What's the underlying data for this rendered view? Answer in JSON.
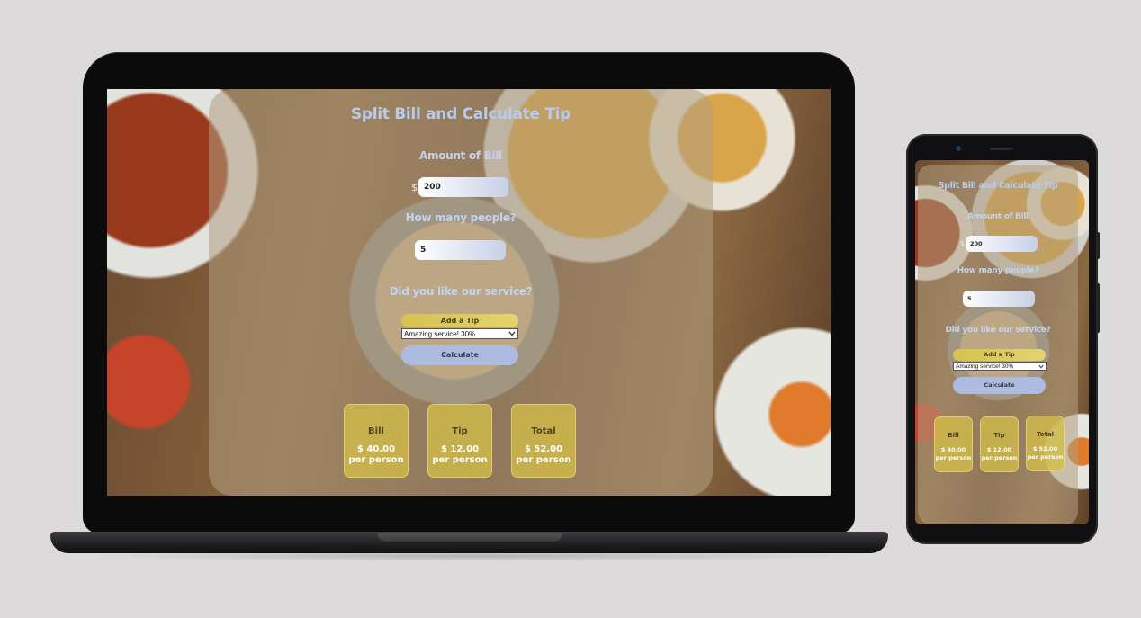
{
  "app": {
    "title": "Split Bill and Calculate Tip",
    "bill": {
      "label": "Amount of Bill",
      "currency": "$",
      "value": "200"
    },
    "people": {
      "label": "How many people?",
      "value": "5"
    },
    "service": {
      "label": "Did you like our service?",
      "tip_button": "Add a Tip",
      "selected_option": "Amazing service! 30%"
    },
    "calculate_button": "Calculate",
    "results": [
      {
        "title": "Bill",
        "value": "$ 40.00",
        "unit": "per person"
      },
      {
        "title": "Tip",
        "value": "$ 12.00",
        "unit": "per person"
      },
      {
        "title": "Total",
        "value": "$ 52.00",
        "unit": "per person"
      }
    ]
  },
  "colors": {
    "title": "#b8cbeb",
    "tip_button": "#d6c24e",
    "calculate_button": "#aebbe0",
    "result_card": "#d4be48",
    "background": "#dcdadb"
  },
  "icons": {
    "select": "chevron-down-icon"
  }
}
